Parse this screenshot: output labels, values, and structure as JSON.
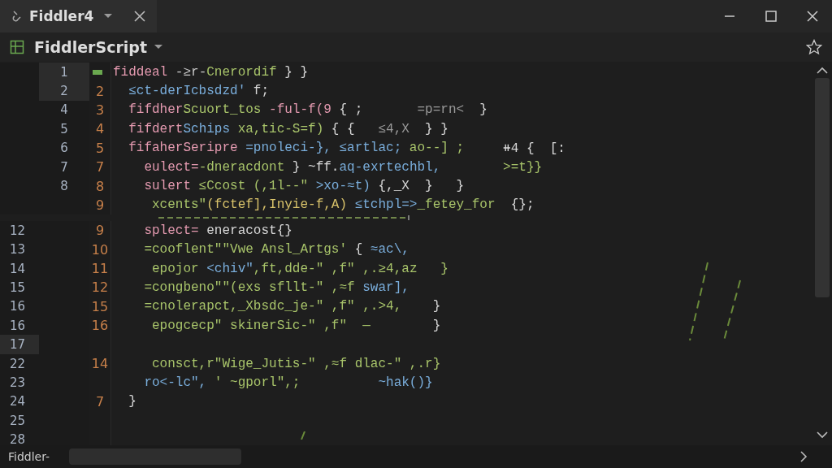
{
  "window": {
    "tab_title": "Fiddler4"
  },
  "toolbar": {
    "title": "FiddlerScript"
  },
  "lines": [
    {
      "kind": "upper",
      "outer_number": "1",
      "highlighted": true,
      "marker": true,
      "segments": [
        {
          "text": "fiddeal",
          "color": "#e49ab0"
        },
        {
          "text": " -≥r-",
          "color": "#c8c8c8"
        },
        {
          "text": "Cnerordif",
          "color": "#a8c46a"
        },
        {
          "text": " } }",
          "color": "#d8d8d8"
        }
      ]
    },
    {
      "kind": "upper",
      "outer_number": "2",
      "inner_number": "2",
      "highlighted": true,
      "segments": [
        {
          "text": "  ≤ct-derIcbsdzd'",
          "color": "#7aaedc"
        },
        {
          "text": " f;",
          "color": "#d8d8d8"
        }
      ]
    },
    {
      "kind": "upper",
      "outer_number": "4",
      "inner_number": "3",
      "highlighted": false,
      "segments": [
        {
          "text": "  fifdher",
          "color": "#e49ab0"
        },
        {
          "text": "Scuort_tos",
          "color": "#a8c46a"
        },
        {
          "text": " -ful-f(9",
          "color": "#e49ab0"
        },
        {
          "text": " { ;",
          "color": "#d8d8d8"
        },
        {
          "text": "       =p=rn<",
          "color": "#9a9a9a"
        },
        {
          "text": "  }",
          "color": "#d8d8d8"
        }
      ]
    },
    {
      "kind": "upper",
      "outer_number": "5",
      "inner_number": "4",
      "highlighted": false,
      "segments": [
        {
          "text": "  fifdert",
          "color": "#e49ab0"
        },
        {
          "text": "Schips",
          "color": "#7aaedc"
        },
        {
          "text": " xa,tic-S=f)",
          "color": "#a8c46a"
        },
        {
          "text": " { {   ",
          "color": "#d8d8d8"
        },
        {
          "text": "≤4,X",
          "color": "#9a9a9a"
        },
        {
          "text": "  } }",
          "color": "#d8d8d8"
        }
      ]
    },
    {
      "kind": "upper",
      "outer_number": "6",
      "inner_number": "5",
      "highlighted": false,
      "segments": [
        {
          "text": "  fifaherSeripre",
          "color": "#e49ab0"
        },
        {
          "text": " =pnoleci-},",
          "color": "#7aaedc"
        },
        {
          "text": " ≤artlac;",
          "color": "#7aaedc"
        },
        {
          "text": " ao--] ;",
          "color": "#a8c46a"
        },
        {
          "text": "     ⧺4 {  [:",
          "color": "#d8d8d8"
        }
      ]
    },
    {
      "kind": "upper",
      "outer_number": "7",
      "inner_number": "7",
      "highlighted": false,
      "segments": [
        {
          "text": "    eulect=",
          "color": "#e49ab0"
        },
        {
          "text": "-dneracdont",
          "color": "#a8c46a"
        },
        {
          "text": " } ~ff.",
          "color": "#d8d8d8"
        },
        {
          "text": "aq-exrtechbl,",
          "color": "#7aaedc"
        },
        {
          "text": "        >=t}}",
          "color": "#a8c46a"
        }
      ]
    },
    {
      "kind": "upper",
      "outer_number": "8",
      "inner_number": "8",
      "highlighted": false,
      "segments": [
        {
          "text": "    sulert",
          "color": "#e49ab0"
        },
        {
          "text": " ≤Ccost (,1l--\"",
          "color": "#a8c46a"
        },
        {
          "text": " >xo-≈t)",
          "color": "#7aaedc"
        },
        {
          "text": " {,_X  }   }",
          "color": "#d8d8d8"
        }
      ]
    },
    {
      "kind": "upper",
      "inner_number": "9",
      "highlighted": false,
      "underline": true,
      "segments": [
        {
          "text": "     xcents\"",
          "color": "#a8c46a"
        },
        {
          "text": "(fctef],",
          "color": "#d8c26a"
        },
        {
          "text": "Inyie-f,A)",
          "color": "#d8c26a"
        },
        {
          "text": " ≤tchpl=>",
          "color": "#7aaedc"
        },
        {
          "text": "_fetey_for",
          "color": "#a8c46a"
        },
        {
          "text": "  {};",
          "color": "#d8d8d8"
        }
      ]
    },
    {
      "kind": "lower",
      "outer_number": "12",
      "inner_number": "9",
      "highlighted": false,
      "segments": [
        {
          "text": "    splect=",
          "color": "#e49ab0"
        },
        {
          "text": " eneracost{}",
          "color": "#d8d8d8"
        }
      ]
    },
    {
      "kind": "lower",
      "outer_number": "13",
      "inner_number": "10",
      "highlighted": false,
      "segments": [
        {
          "text": "    =cooflent\"\"Vwe Ansl_Artgs'",
          "color": "#a8c46a"
        },
        {
          "text": " {",
          "color": "#d8d8d8"
        },
        {
          "text": " ≈ac\\,",
          "color": "#7aaedc"
        }
      ]
    },
    {
      "kind": "lower",
      "outer_number": "14",
      "inner_number": "11",
      "highlighted": false,
      "segments": [
        {
          "text": "     epojor",
          "color": "#a8c46a"
        },
        {
          "text": " <chiv\"",
          "color": "#7aaedc"
        },
        {
          "text": ",ft,dde-\" ,f\" ,.≥4,az   }",
          "color": "#a8c46a"
        }
      ]
    },
    {
      "kind": "lower",
      "outer_number": "15",
      "inner_number": "12",
      "highlighted": false,
      "segments": [
        {
          "text": "    =congbeno\"\"(exs sfllt-\" ,≈f",
          "color": "#a8c46a"
        },
        {
          "text": " swar],",
          "color": "#7aaedc"
        }
      ]
    },
    {
      "kind": "lower",
      "outer_number": "16",
      "inner_number": "15",
      "highlighted": false,
      "segments": [
        {
          "text": "    =cnolerapct,_Xbsdc_je-\" ,f\" ,.>4,",
          "color": "#a8c46a"
        },
        {
          "text": "    }",
          "color": "#d8d8d8"
        }
      ]
    },
    {
      "kind": "lower",
      "outer_number": "16",
      "inner_number": "16",
      "highlighted": false,
      "segments": [
        {
          "text": "     epogcecp\" skinerSic-\" ,f\"  —",
          "color": "#a8c46a"
        },
        {
          "text": "        }",
          "color": "#d8d8d8"
        }
      ]
    },
    {
      "kind": "lower",
      "outer_number": "17",
      "highlighted": true
    },
    {
      "kind": "lower",
      "outer_number": "22",
      "inner_number": "14",
      "highlighted": false,
      "segments": [
        {
          "text": "     consct,r\"Wige_Jutis-\" ,≈f dlac-\" ,.r}",
          "color": "#a8c46a"
        }
      ]
    },
    {
      "kind": "lower",
      "outer_number": "23",
      "highlighted": false,
      "segments": [
        {
          "text": "    ro<-lc\",",
          "color": "#7aaedc"
        },
        {
          "text": " ' ~gporl\",;",
          "color": "#a8c46a"
        },
        {
          "text": "          ~hak()}",
          "color": "#7aaedc"
        }
      ]
    },
    {
      "kind": "lower",
      "outer_number": "24",
      "inner_number": "7",
      "highlighted": false,
      "segments": [
        {
          "text": "  }",
          "color": "#d8d8d8"
        }
      ]
    },
    {
      "kind": "lower",
      "outer_number": "25",
      "highlighted": false
    },
    {
      "kind": "lower",
      "outer_number": "28",
      "highlighted": false
    }
  ],
  "status_bar": {
    "label": "Fiddler-"
  }
}
